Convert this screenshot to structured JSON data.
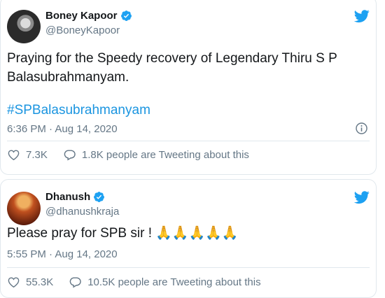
{
  "tweets": [
    {
      "author_name": "Boney Kapoor",
      "handle": "@BoneyKapoor",
      "text": "Praying for the Speedy recovery of Legendary Thiru S P Balasubrahmanyam.",
      "hashtag": "#SPBalasubrahmanyam",
      "timestamp": "6:36 PM · Aug 14, 2020",
      "likes": "7.3K",
      "discussion": "1.8K people are Tweeting about this"
    },
    {
      "author_name": "Dhanush",
      "handle": "@dhanushkraja",
      "text": "Please pray for SPB sir ! 🙏🙏🙏🙏🙏",
      "timestamp": "5:55 PM · Aug 14, 2020",
      "likes": "55.3K",
      "discussion": "10.5K people are Tweeting about this"
    }
  ],
  "colors": {
    "twitter_blue": "#1da1f2",
    "hashtag_blue": "#1b95e0",
    "secondary_text": "#657786",
    "primary_text": "#14171a",
    "border": "#e1e8ed"
  },
  "icons": {
    "logo": "twitter-bird-icon",
    "verified": "verified-badge-icon",
    "info": "info-icon",
    "like": "heart-icon",
    "reply": "speech-bubble-icon"
  }
}
